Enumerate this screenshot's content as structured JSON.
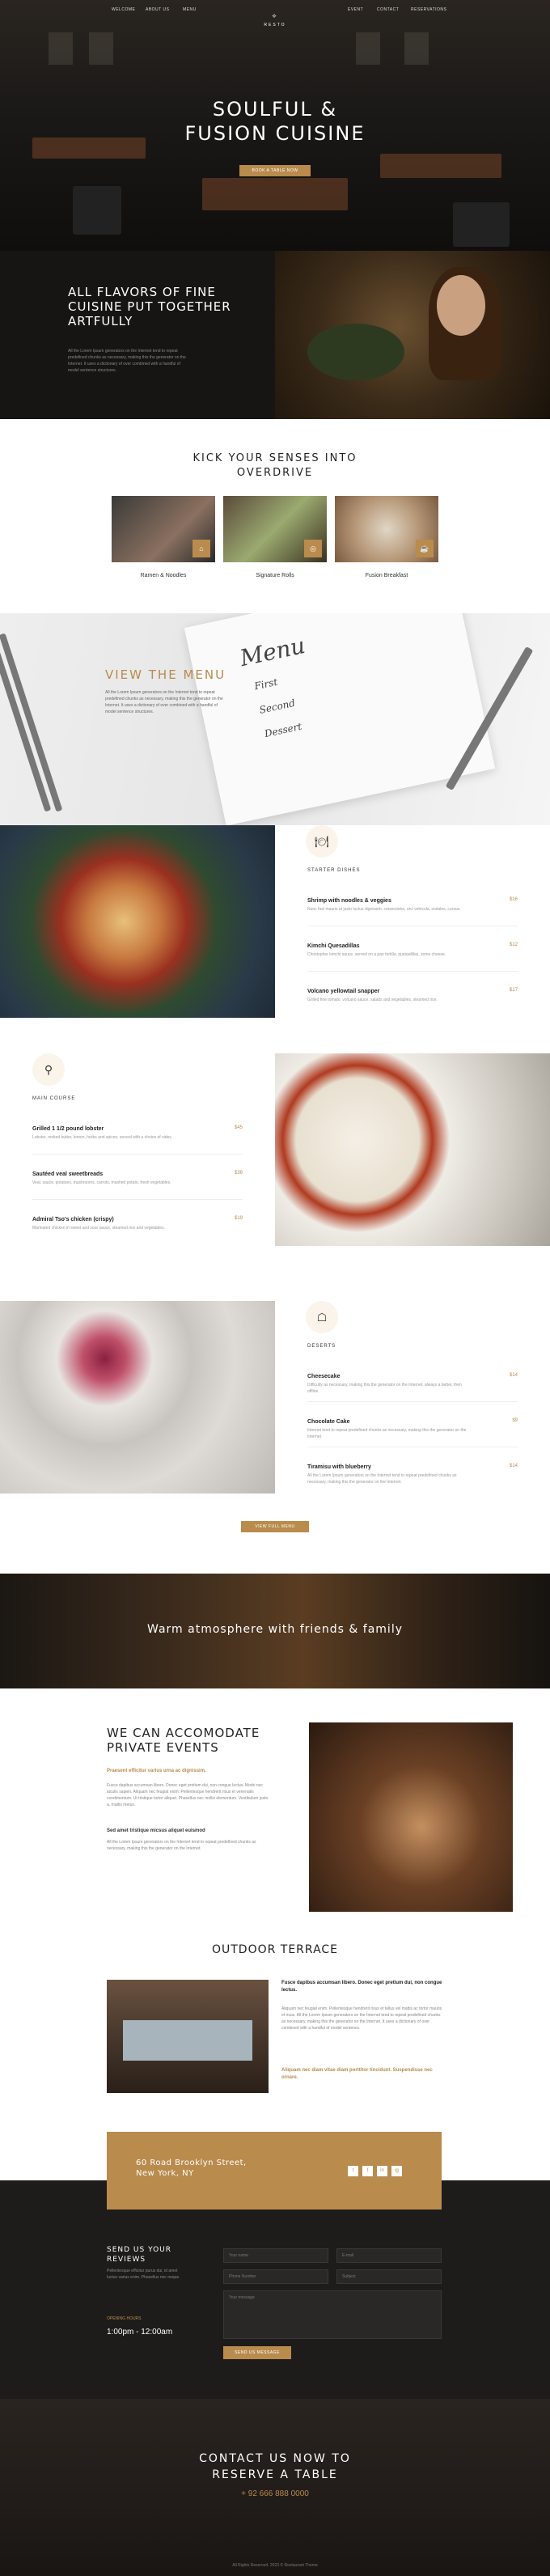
{
  "nav": {
    "left": [
      "WELCOME",
      "ABOUT US",
      "MENU"
    ],
    "right": [
      "EVENT",
      "CONTACT",
      "RESERVATIONS"
    ],
    "logo": "RESTO"
  },
  "hero": {
    "title_line1": "SOULFUL &",
    "title_line2": "FUSION CUISINE",
    "button": "BOOK A TABLE NOW"
  },
  "flavors": {
    "title": "ALL FLAVORS OF FINE CUISINE PUT TOGETHER ARTFULLY",
    "text": "All the Lorem Ipsum generators on the Internet tend to repeat predefined chunks as necessary, making this the generator on the Internet. It uses a dictionary of over combined with a handful of model sentence structures."
  },
  "kick": {
    "title_line1": "KICK YOUR SENSES INTO",
    "title_line2": "OVERDRIVE",
    "cards": [
      {
        "label": "Ramen & Noodles"
      },
      {
        "label": "Signature Rolls"
      },
      {
        "label": "Fusion Breakfast"
      }
    ]
  },
  "menu": {
    "title": "VIEW THE MENU",
    "text": "All the Lorem Ipsum generators on the Internet tend to repeat predefined chunks as necessary, making this the generator on the Internet. It uses a dictionary of over combined with a handful of model sentence structures."
  },
  "starter": {
    "heading": "STARTER DISHES",
    "items": [
      {
        "name": "Shrimp with noodles & veggies",
        "price": "$16",
        "desc": "Nunc fast mauris ut justo luctus dignissim, consectetur, orci vehicula, sodales, cursus."
      },
      {
        "name": "Kimchi Quesadillas",
        "price": "$12",
        "desc": "Christopher kimchi sauce, served on a pan tortilla, quesadillas, some cheese."
      },
      {
        "name": "Volcano yellowtail snapper",
        "price": "$17",
        "desc": "Grilled fine tomato, volcano sauce, salads and vegetables, steamed rice."
      }
    ]
  },
  "main": {
    "heading": "MAIN COURSE",
    "items": [
      {
        "name": "Grilled 1 1/2 pound lobster",
        "price": "$45",
        "desc": "Lobster, melted butter, lemon, herbs and spices, served with a choice of sides."
      },
      {
        "name": "Sautéed veal sweetbreads",
        "price": "$36",
        "desc": "Veal, sauce, potatoes, mushrooms, carrots, mashed potato, fresh vegetables."
      },
      {
        "name": "Admiral Tso's chicken (crispy)",
        "price": "$19",
        "desc": "Marinated chicken in sweet and sour sauce, steamed rice and vegetables."
      }
    ]
  },
  "desserts": {
    "heading": "DESERTS",
    "items": [
      {
        "name": "Cheesecake",
        "price": "$14",
        "desc": "Difficulty as necessary, making this the generator on the Internet, always a better, then offline."
      },
      {
        "name": "Chocolate Cake",
        "price": "$9",
        "desc": "Internet tend to repeat predefined chunks as necessary, making this the generator on the Internet."
      },
      {
        "name": "Tiramisu with blueberry",
        "price": "$14",
        "desc": "All the Lorem Ipsum generators on the Internet tend to repeat predefined chunks as necessary, making this the generator on the Internet."
      }
    ],
    "button": "VIEW FULL MENU"
  },
  "warm": {
    "text": "Warm atmosphere with friends & family"
  },
  "events": {
    "title": "WE CAN ACCOMODATE PRIVATE EVENTS",
    "subtitle": "Praesent efficitur varius urna ac dignissim.",
    "text1": "Fusce dapibus accumsan libero. Donec eget pretium dui, non congue lectus. Morbi nec iaculis sapien. Aliquam nec feugiat enim. Pellentesque hendrerit risus et venenatis condimentum. Ut tristique tortor aliquet. Phasellus nec mollis elementum. Vestibulum justo a, mattis metus.",
    "subtitle2": "Sed amet tristique micsus aliquet euismod",
    "text2": "All the Lorem Ipsum generators on the Internet tend to repeat predefined chunks as necessary, making this the generator on the Internet."
  },
  "terrace": {
    "title": "OUTDOOR TERRACE",
    "heading": "Fusce dapibus accumsan libero. Donec eget pretium dui, non congue lectus.",
    "text": "Aliquam nec feugiat enim. Pellentesque hendrerit risus et tellus vel mattis ac tortor mauris et risus. All the Lorem Ipsum generators on the Internet tend to repeat predefined chunks as necessary, making this the generator on the Internet. It uses a dictionary of over combined with a handful of model sentence.",
    "gold": "Aliquam nec diam vitae diam porttitor tincidunt. Suspendisse nec ornare."
  },
  "address": {
    "line1": "60 Road Brooklyn Street,",
    "line2": "New York, NY",
    "social": [
      "t",
      "f",
      "in",
      "ig"
    ]
  },
  "reviews": {
    "title_line1": "SEND US YOUR",
    "title_line2": "REVIEWS",
    "text": "Pellentesque efficitur purus dui, id amet luctus varius enim. Phasellus nec neque.",
    "open_label": "OPENING HOURS",
    "hours": "1:00pm - 12:00am",
    "fields": [
      "Your name",
      "E-mail",
      "Phone Number",
      "Subject",
      "Your message"
    ],
    "button": "SEND US MESSAGE"
  },
  "contact": {
    "line1": "CONTACT US NOW TO",
    "line2": "RESERVE A TABLE",
    "phone": "+ 92 666 888 0000",
    "footer": "All Rights Reserved. 2023 © Restaurant Theme"
  },
  "colors": {
    "accent": "#b98b4d",
    "dark": "#1e1c1a"
  }
}
